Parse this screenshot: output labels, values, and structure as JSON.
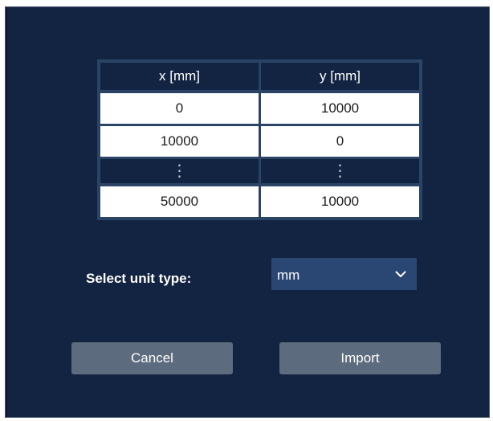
{
  "table": {
    "headers": [
      "x [mm]",
      "y [mm]"
    ],
    "rows": [
      [
        "0",
        "10000"
      ],
      [
        "10000",
        "0"
      ],
      [
        "50000",
        "10000"
      ]
    ],
    "ellipsis": "⋮"
  },
  "unit": {
    "label": "Select unit type:",
    "selected": "mm"
  },
  "buttons": {
    "cancel": "Cancel",
    "import": "Import"
  },
  "icons": {
    "dropdown": "chevron-down-icon"
  },
  "colors": {
    "dialog_bg": "#132443",
    "select_bg": "#2a4673",
    "button_bg": "#5d6b7e"
  }
}
